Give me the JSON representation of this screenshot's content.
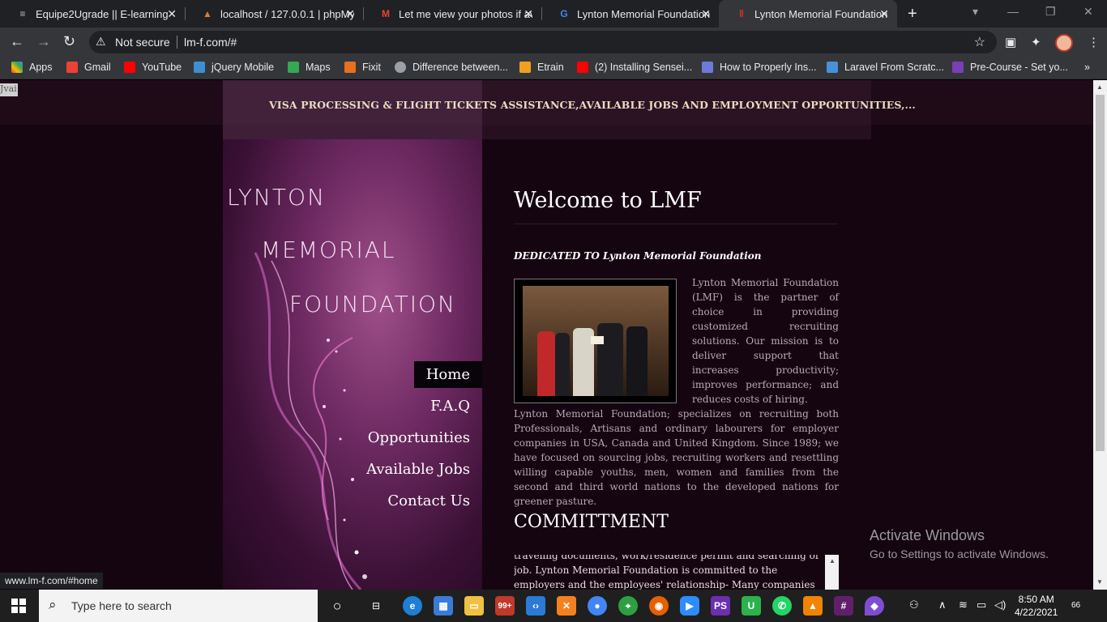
{
  "browser": {
    "tabs": [
      {
        "title": "Equipe2Ugrade || E-learning",
        "icon_color": "#bfbfbf"
      },
      {
        "title": "localhost / 127.0.0.1 | phpMyA",
        "icon_color": "#e07b2c"
      },
      {
        "title": "Let me view your photos if av",
        "icon_color": "#ea4335"
      },
      {
        "title": "Lynton Memorial Foundation",
        "icon_color": "#4285f4"
      },
      {
        "title": "Lynton Memorial Foundation",
        "icon_color": "#d93025"
      }
    ],
    "address": {
      "security": "Not secure",
      "url": "lm-f.com/#"
    },
    "bookmarks": [
      "Apps",
      "Gmail",
      "YouTube",
      "jQuery Mobile",
      "Maps",
      "Fixit",
      "Difference between...",
      "Etrain",
      "(2) Installing Sensei...",
      "How to Properly Ins...",
      "Laravel From Scratc...",
      "Pre-Course - Set yo..."
    ],
    "status_url": "www.lm-f.com/#home"
  },
  "site": {
    "jvai": "Jvai",
    "marquee": "VISA PROCESSING & FLIGHT TICKETS ASSISTANCE,AVAILABLE JOBS AND EMPLOYMENT OPPORTUNITIES,...",
    "logo": [
      "LYNTON",
      "MEMORIAL",
      "FOUNDATION"
    ],
    "nav": [
      "Home",
      "F.A.Q",
      "Opportunities",
      "Available Jobs",
      "Contact Us"
    ],
    "welcome": "Welcome to LMF",
    "dedicated": "DEDICATED TO Lynton Memorial Foundation",
    "intro": "Lynton Memorial Foundation (LMF) is the partner of choice in providing customized recruiting solutions. Our mission is to deliver support that increases productivity; improves performance; and reduces costs of hiring.",
    "about": "Lynton Memorial Foundation; specializes on recruiting both Professionals, Artisans and ordinary labourers for employer companies in USA, Canada and United Kingdom. Since 1989; we have focused on sourcing jobs, recruiting workers and resettling willing capable youths, men, women and families from the second and third world nations to the developed nations for greener pasture.",
    "commitment_heading": "COMMITTMENT",
    "commitment_text": "traveling documents, work/residence permit and searching of job. Lynton Memorial Foundation is committed to the employers and the employees' relationship- Many companies in USA, Canada and United"
  },
  "os": {
    "activate_title": "Activate Windows",
    "activate_sub": "Go to Settings to activate Windows.",
    "search_placeholder": "Type here to search",
    "time": "8:50 AM",
    "date": "4/22/2021",
    "notifications": "66",
    "badge": "99+"
  }
}
